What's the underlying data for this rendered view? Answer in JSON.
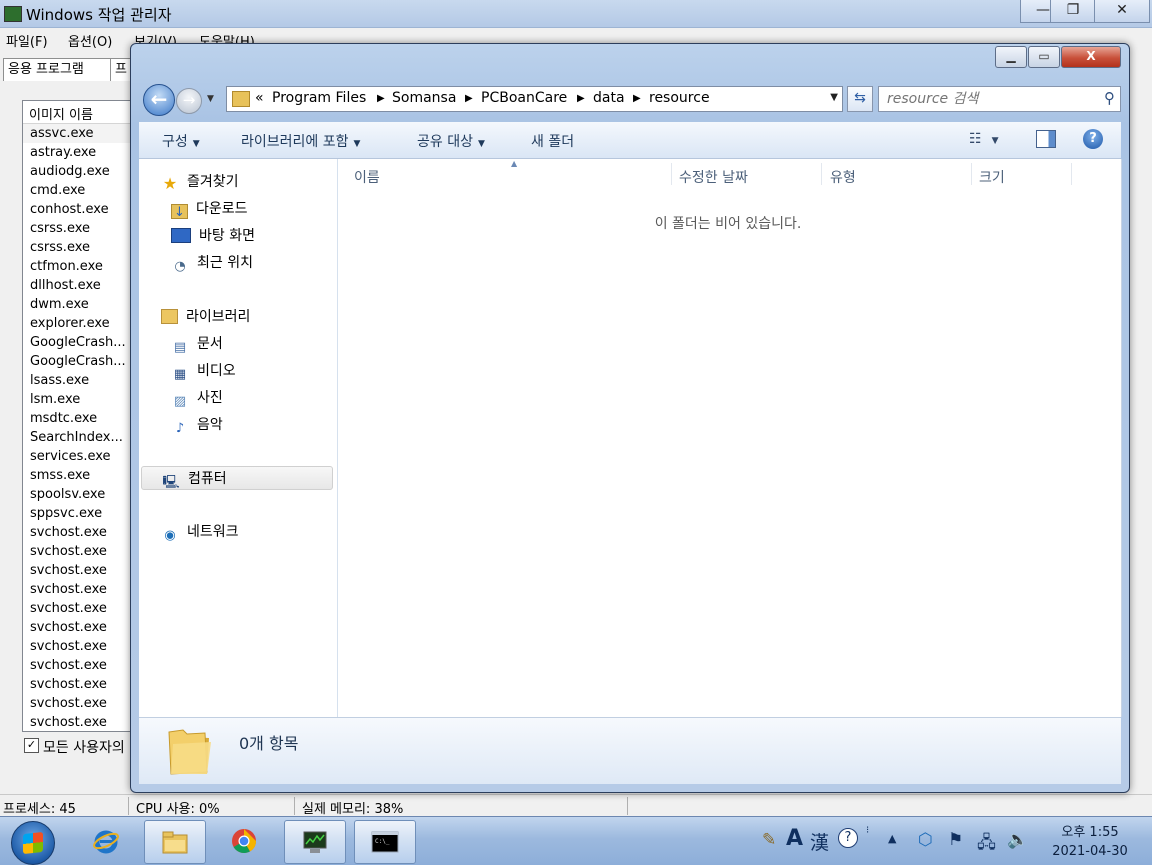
{
  "task_manager": {
    "title": "Windows 작업 관리자",
    "caption_buttons": {
      "minimize": "—",
      "maximize": "❐",
      "close": "✕"
    },
    "menu": [
      "파일(F)",
      "옵션(O)",
      "보기(V)",
      "도움말(H)"
    ],
    "tabs": [
      "응용 프로그램",
      "프"
    ],
    "column_header": "이미지 이름",
    "processes": [
      "assvc.exe",
      "astray.exe",
      "audiodg.exe",
      "cmd.exe",
      "conhost.exe",
      "csrss.exe",
      "csrss.exe",
      "ctfmon.exe",
      "dllhost.exe",
      "dwm.exe",
      "explorer.exe",
      "GoogleCrash...",
      "GoogleCrash...",
      "lsass.exe",
      "lsm.exe",
      "msdtc.exe",
      "SearchIndex...",
      "services.exe",
      "smss.exe",
      "spoolsv.exe",
      "sppsvc.exe",
      "svchost.exe",
      "svchost.exe",
      "svchost.exe",
      "svchost.exe",
      "svchost.exe",
      "svchost.exe",
      "svchost.exe",
      "svchost.exe",
      "svchost.exe",
      "svchost.exe",
      "svchost.exe"
    ],
    "show_all_checkbox": {
      "checked": true,
      "label": "모든 사용자의"
    },
    "status": {
      "processes": "프로세스: 45",
      "cpu": "CPU 사용: 0%",
      "memory": "실제 메모리: 38%"
    }
  },
  "explorer": {
    "caption_buttons": {
      "minimize": "▁",
      "maximize": "▭",
      "close": "X"
    },
    "address": {
      "overflow": "«",
      "crumbs": [
        "Program Files",
        "Somansa",
        "PCBoanCare",
        "data",
        "resource"
      ]
    },
    "search_placeholder": "resource 검색",
    "toolbar": {
      "organize": "구성",
      "include_in_library": "라이브러리에 포함",
      "share_with": "공유 대상",
      "new_folder": "새 폴더"
    },
    "nav": {
      "favorites": "즐겨찾기",
      "downloads": "다운로드",
      "desktop": "바탕 화면",
      "recent": "최근 위치",
      "libraries": "라이브러리",
      "documents": "문서",
      "videos": "비디오",
      "pictures": "사진",
      "music": "음악",
      "computer": "컴퓨터",
      "network": "네트워크"
    },
    "columns": [
      "이름",
      "수정한 날짜",
      "유형",
      "크기"
    ],
    "empty_message": "이 폴더는 비어 있습니다.",
    "item_count": "0개 항목"
  },
  "taskbar": {
    "apps": [
      "internet-explorer",
      "windows-explorer",
      "chrome",
      "task-manager",
      "command-prompt"
    ],
    "ime": {
      "mode": "A",
      "hanja": "漢"
    },
    "clock": {
      "time": "오후 1:55",
      "date": "2021-04-30"
    }
  },
  "colors": {
    "accent": "#3b78c8",
    "window_frame": "#a9c3e4",
    "close": "#c8503a"
  }
}
